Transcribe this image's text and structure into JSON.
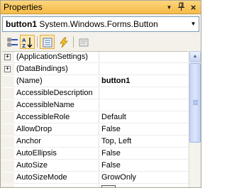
{
  "window": {
    "title": "Properties",
    "dropdown_glyph": "▼",
    "pin_glyph": "ᵩ",
    "close_glyph": "×"
  },
  "selector": {
    "object_name": "button1",
    "object_type": " System.Windows.Forms.Button",
    "arrow_glyph": "▼"
  },
  "toolbar": {
    "buttons": [
      {
        "icon": "categorized-icon",
        "active": false
      },
      {
        "icon": "alphabetical-sort-icon",
        "active": true
      },
      {
        "icon": "properties-icon",
        "active": true
      },
      {
        "icon": "events-icon",
        "active": false
      },
      {
        "icon": "property-pages-icon",
        "active": false
      }
    ]
  },
  "grid": {
    "expander_glyph": "+",
    "rows": [
      {
        "name": "(ApplicationSettings)",
        "value": "",
        "expandable": true
      },
      {
        "name": "(DataBindings)",
        "value": "",
        "expandable": true
      },
      {
        "name": "(Name)",
        "value": "button1",
        "bold_value": true
      },
      {
        "name": "AccessibleDescription",
        "value": ""
      },
      {
        "name": "AccessibleName",
        "value": ""
      },
      {
        "name": "AccessibleRole",
        "value": "Default"
      },
      {
        "name": "AllowDrop",
        "value": "False"
      },
      {
        "name": "Anchor",
        "value": "Top, Left"
      },
      {
        "name": "AutoEllipsis",
        "value": "False"
      },
      {
        "name": "AutoSize",
        "value": "False"
      },
      {
        "name": "AutoSizeMode",
        "value": "GrowOnly"
      }
    ]
  },
  "scrollbar": {
    "up_glyph": "▲"
  }
}
